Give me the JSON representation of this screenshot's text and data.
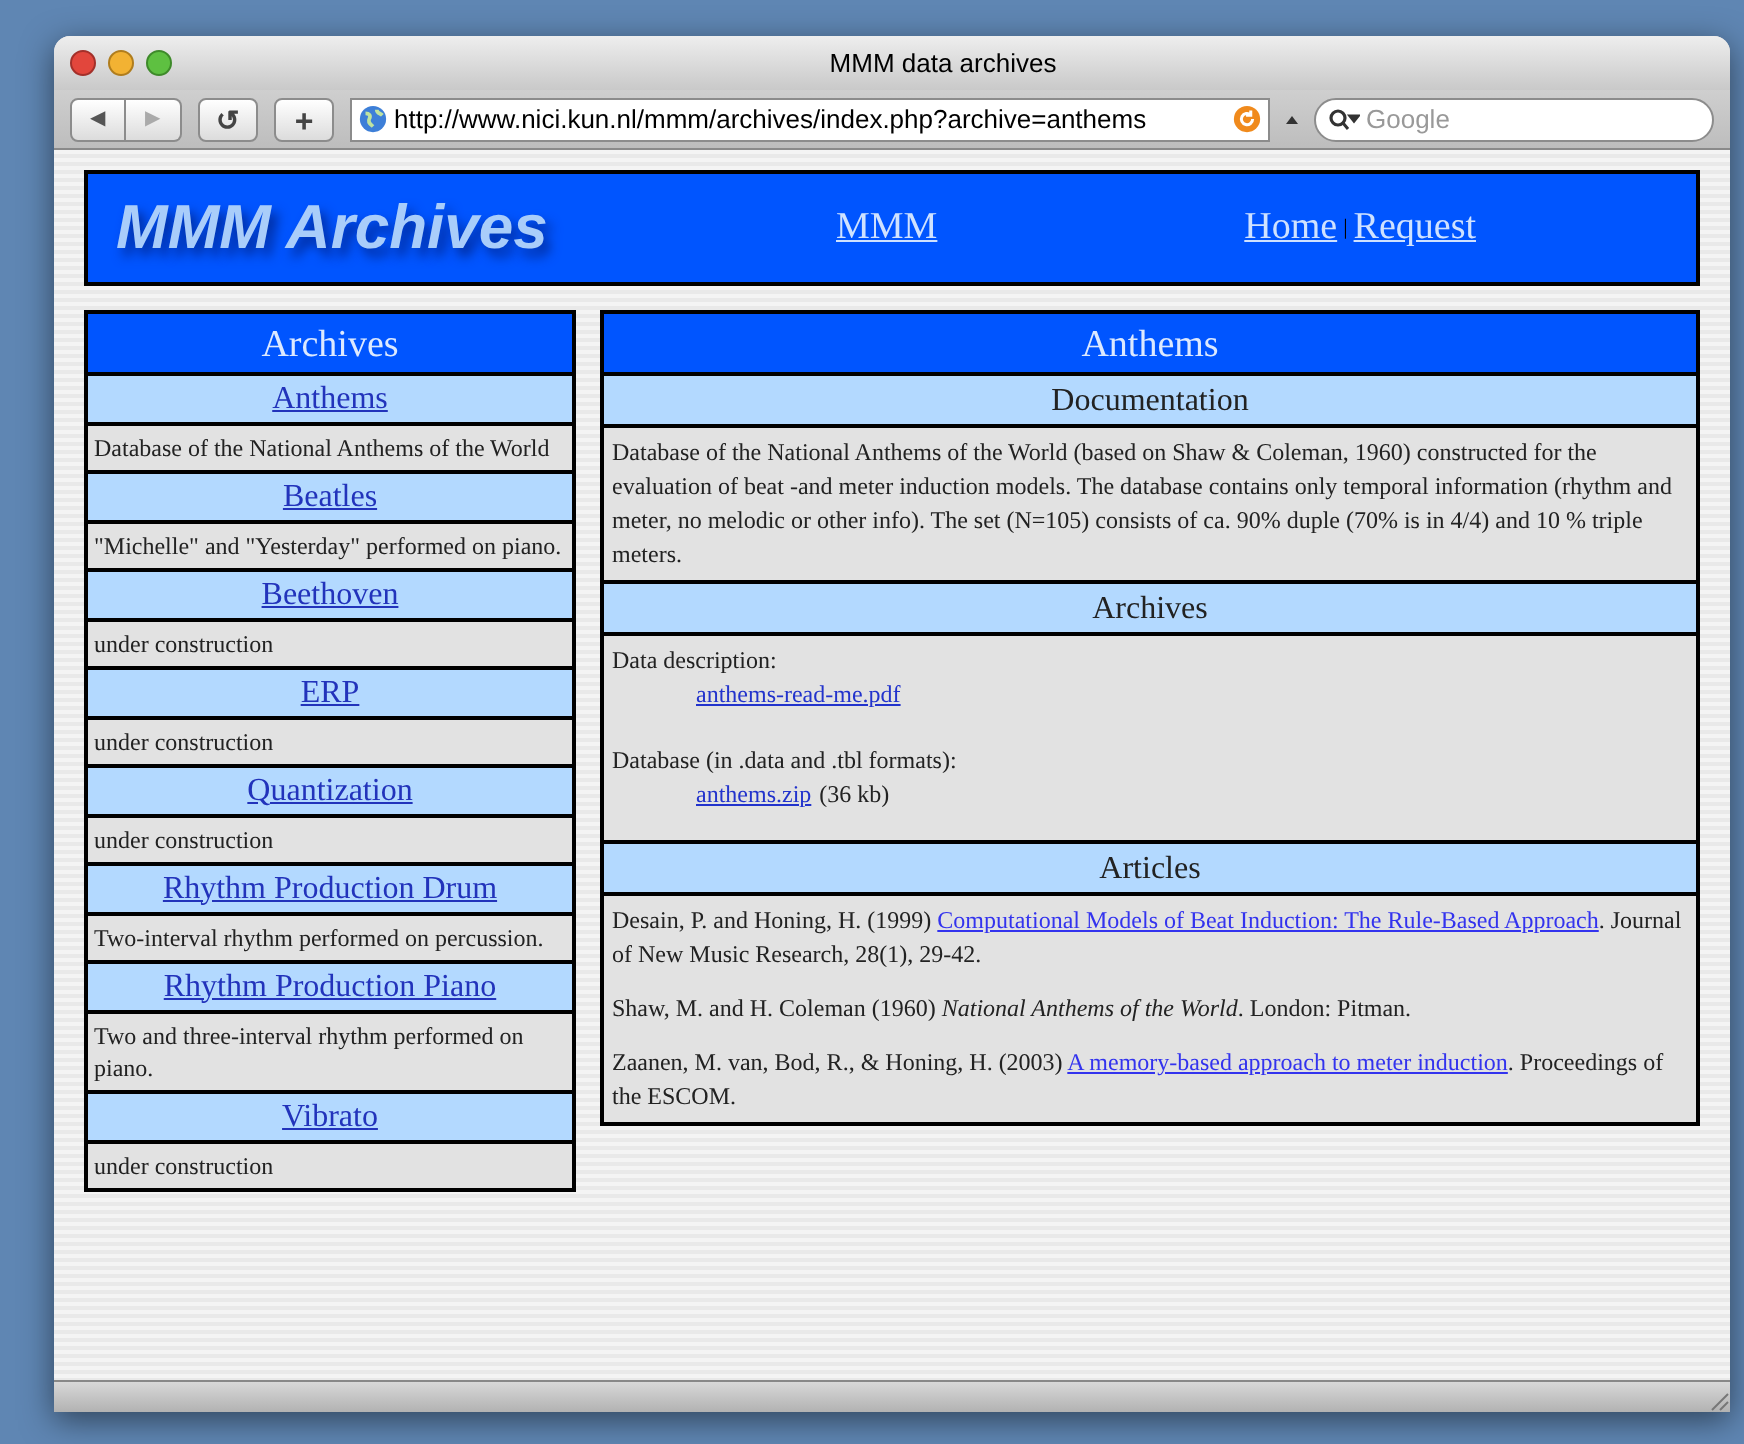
{
  "window": {
    "title": "MMM data archives"
  },
  "toolbar": {
    "back": "◀",
    "forward": "▶",
    "reload": "↺",
    "add": "+",
    "url": "http://www.nici.kun.nl/mmm/archives/index.php?archive=anthems",
    "search_placeholder": "Google"
  },
  "banner": {
    "logo": "MMM Archives",
    "links": [
      {
        "label": "MMM"
      },
      {
        "label": "Home"
      },
      {
        "label": "Request"
      }
    ],
    "separator": "|"
  },
  "sidebar": {
    "title": "Archives",
    "items": [
      {
        "title": "Anthems",
        "description": "Database of the National Anthems of the World"
      },
      {
        "title": "Beatles",
        "description": "\"Michelle\" and \"Yesterday\" performed on piano."
      },
      {
        "title": "Beethoven",
        "description": "under construction"
      },
      {
        "title": "ERP",
        "description": "under construction"
      },
      {
        "title": "Quantization",
        "description": "under construction"
      },
      {
        "title": "Rhythm Production Drum",
        "description": "Two-interval rhythm performed on percussion."
      },
      {
        "title": "Rhythm Production Piano",
        "description": "Two and three-interval rhythm performed on piano."
      },
      {
        "title": "Vibrato",
        "description": "under construction"
      }
    ]
  },
  "main": {
    "title": "Anthems",
    "documentation": {
      "heading": "Documentation",
      "text": "Database of the National Anthems of the World (based on Shaw & Coleman, 1960) constructed for the evaluation of beat -and meter induction models. The database contains only temporal information (rhythm and meter, no melodic or other info). The set (N=105) consists of ca. 90% duple (70% is in 4/4) and 10 % triple meters."
    },
    "archives": {
      "heading": "Archives",
      "files": [
        {
          "label": "Data description:",
          "link": "anthems-read-me.pdf"
        },
        {
          "label": "Database (in .data and .tbl formats):",
          "link": "anthems.zip",
          "size": "(36 kb)"
        }
      ]
    },
    "articles": {
      "heading": "Articles",
      "entries": [
        [
          {
            "text": "Desain, P. and Honing, H. (1999) "
          },
          {
            "text": "Computational Models of Beat Induction: The Rule-Based Approach",
            "link": true
          },
          {
            "text": ". Journal of New Music Research, 28(1), 29-42."
          }
        ],
        [
          {
            "text": "Shaw, M. and H. Coleman (1960) *National Anthems of the World*. London: Pitman."
          }
        ],
        [
          {
            "text": "Zaanen, M. van, Bod, R., & Honing, H. (2003) "
          },
          {
            "text": "A memory-based approach to meter induction",
            "link": true
          },
          {
            "text": ". Proceedings of the ESCOM."
          }
        ]
      ]
    }
  }
}
